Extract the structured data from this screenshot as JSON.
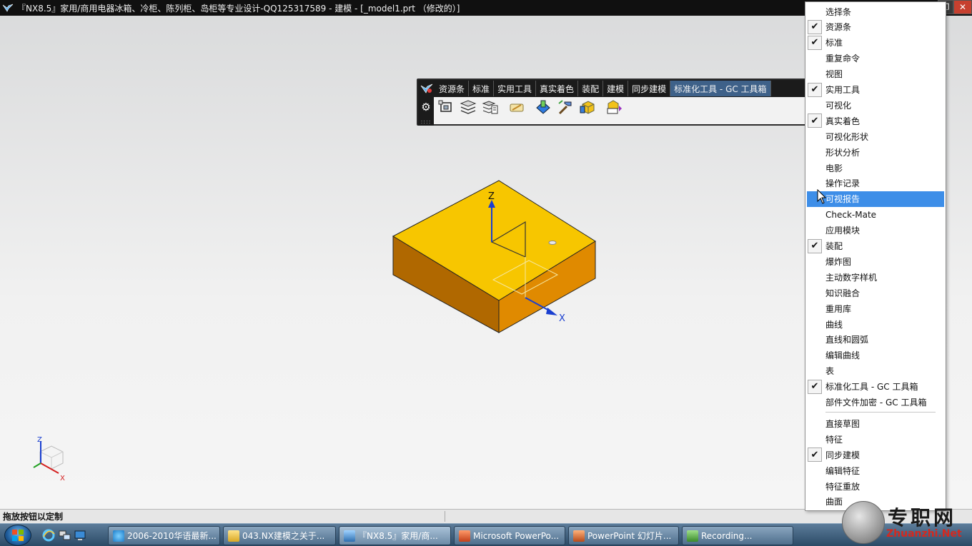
{
  "window": {
    "title": "『NX8.5』家用/商用电器冰箱、冷柜、陈列柜、岛柜等专业设计-QQ125317589 - 建模 - [_model1.prt （修改的）]",
    "buttons": [
      "restore",
      "close"
    ]
  },
  "toolbar": {
    "tabs": [
      "资源条",
      "标准",
      "实用工具",
      "真实着色",
      "装配",
      "建模",
      "同步建模",
      "标准化工具 - GC 工具箱"
    ],
    "active_tab": "标准化工具 - GC 工具箱",
    "icons": [
      "component-frame-icon",
      "layers-stack-icon",
      "layers-list-icon",
      "pencil-note-icon",
      "part-blue-icon",
      "hammer-icon",
      "cube-yellow-icon",
      "text-cube-icon"
    ]
  },
  "viewport": {
    "axis_labels": {
      "z": "Z",
      "x": "X"
    },
    "triad_labels": {
      "z": "Z",
      "x": "X"
    },
    "colors": {
      "top_face": "#f7c600",
      "side_face": "#e08a00",
      "front_face": "#b06800",
      "axis": "#1a3fd0"
    }
  },
  "menu": {
    "items": [
      {
        "label": "选择条",
        "checked": false
      },
      {
        "label": "资源条",
        "checked": true
      },
      {
        "label": "标准",
        "checked": true
      },
      {
        "label": "重复命令",
        "checked": false
      },
      {
        "label": "视图",
        "checked": false
      },
      {
        "label": "实用工具",
        "checked": true
      },
      {
        "label": "可视化",
        "checked": false
      },
      {
        "label": "真实着色",
        "checked": true
      },
      {
        "label": "可视化形状",
        "checked": false
      },
      {
        "label": "形状分析",
        "checked": false
      },
      {
        "label": "电影",
        "checked": false
      },
      {
        "label": "操作记录",
        "checked": false
      },
      {
        "label": "可视报告",
        "checked": false,
        "highlighted": true
      },
      {
        "label": "Check-Mate",
        "checked": false
      },
      {
        "label": "应用模块",
        "checked": false
      },
      {
        "label": "装配",
        "checked": true
      },
      {
        "label": "爆炸图",
        "checked": false
      },
      {
        "label": "主动数字样机",
        "checked": false
      },
      {
        "label": "知识融合",
        "checked": false
      },
      {
        "label": "重用库",
        "checked": false
      },
      {
        "label": "曲线",
        "checked": false
      },
      {
        "label": "直线和圆弧",
        "checked": false
      },
      {
        "label": "编辑曲线",
        "checked": false
      },
      {
        "label": "表",
        "checked": false
      },
      {
        "label": "标准化工具 - GC 工具箱",
        "checked": true
      },
      {
        "label": "部件文件加密 - GC 工具箱",
        "checked": false
      },
      {
        "label": "直接草图",
        "checked": false
      },
      {
        "label": "特征",
        "checked": false
      },
      {
        "label": "同步建模",
        "checked": true
      },
      {
        "label": "编辑特征",
        "checked": false
      },
      {
        "label": "特征重放",
        "checked": false
      },
      {
        "label": "曲面",
        "checked": false
      }
    ],
    "highlight_color": "#3d8ee8"
  },
  "status": {
    "text": "拖放按钮以定制"
  },
  "taskbar": {
    "tasks": [
      {
        "label": "2006-2010华语最新...",
        "icon": "ie-icon"
      },
      {
        "label": "043.NX建模之关于...",
        "icon": "folder-icon"
      },
      {
        "label": "『NX8.5』家用/商...",
        "icon": "nx-icon",
        "active": true
      },
      {
        "label": "Microsoft PowerPo...",
        "icon": "powerpoint-icon"
      },
      {
        "label": "PowerPoint 幻灯片...",
        "icon": "slideshow-icon"
      },
      {
        "label": "Recording...",
        "icon": "recording-icon"
      }
    ]
  },
  "watermark": {
    "text": "专职网",
    "sub": "Zhuanzhi.Net"
  }
}
